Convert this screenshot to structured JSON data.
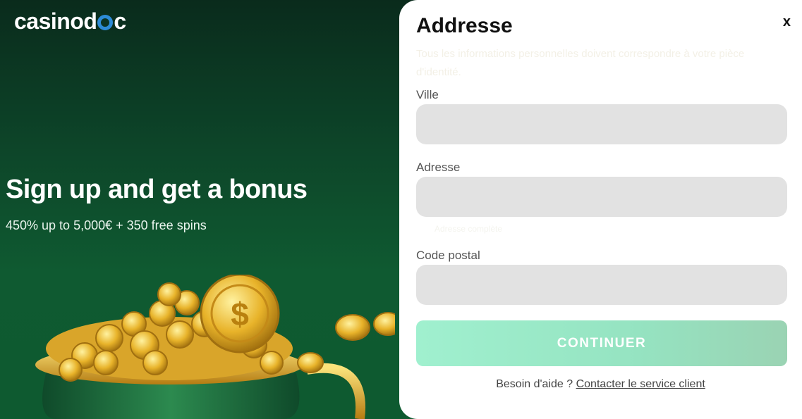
{
  "promo": {
    "logo_text": "casinodoc",
    "title": "Sign up and get a bonus",
    "subtitle": "450% up to 5,000€ + 350 free spins"
  },
  "modal": {
    "title": "Addresse",
    "close_label": "x",
    "faded_text": "Tous les informations personnelles doivent correspondre à votre pièce d'identité.",
    "fields": [
      {
        "label": "Ville",
        "value": "",
        "placeholder": ""
      },
      {
        "label": "Adresse",
        "value": "",
        "placeholder": ""
      },
      {
        "label": "Code postal",
        "value": "",
        "placeholder": ""
      }
    ],
    "faint_hint": "Adresse complète",
    "cta_label": "CONTINUER",
    "help_prefix": "Besoin d'aide ?",
    "help_link": "Contacter le service client"
  },
  "colors": {
    "promo_bg": "#0f5a31",
    "input_bg": "#e2e2e2",
    "cta_bg": "#a0f0cf",
    "logo_accent": "#2d8bd6"
  },
  "icons": {
    "close": "close-icon",
    "logo_mark": "roulette-wheel-icon",
    "illustration": "pot-of-gold-coins"
  }
}
